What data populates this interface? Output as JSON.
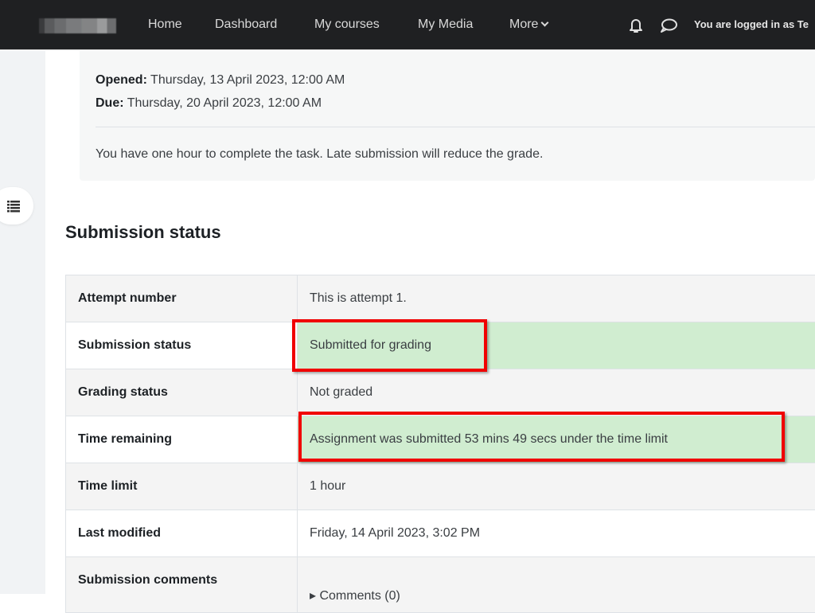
{
  "navbar": {
    "logo_alt": "Site logo (blurred)",
    "items": [
      {
        "label": "Home"
      },
      {
        "label": "Dashboard"
      },
      {
        "label": "My courses"
      },
      {
        "label": "My Media"
      },
      {
        "label": "More"
      }
    ],
    "notifications_icon": "bell-icon",
    "messages_icon": "chat-bubble-icon",
    "user_text": "You are logged in as Te"
  },
  "drawer": {
    "toggle_icon": "list-icon"
  },
  "activity_info": {
    "opened_label": "Opened:",
    "opened_value": " Thursday, 13 April 2023, 12:00 AM",
    "due_label": "Due:",
    "due_value": " Thursday, 20 April 2023, 12:00 AM",
    "description": "You have one hour to complete the task. Late submission will reduce the grade."
  },
  "submission": {
    "title": "Submission status",
    "rows": [
      {
        "label": "Attempt number",
        "value": "This is attempt 1."
      },
      {
        "label": "Submission status",
        "value": "Submitted for grading",
        "status": "success"
      },
      {
        "label": "Grading status",
        "value": "Not graded"
      },
      {
        "label": "Time remaining",
        "value": "Assignment was submitted 53 mins 49 secs under the time limit",
        "status": "success"
      },
      {
        "label": "Time limit",
        "value": "1 hour"
      },
      {
        "label": "Last modified",
        "value": "Friday, 14 April 2023, 3:02 PM"
      },
      {
        "label": "Submission comments",
        "value": "▸ Comments (0)"
      }
    ]
  },
  "colors": {
    "navbar_bg": "#1f2022",
    "success_bg": "#d0edd0",
    "highlight_border": "#f00000"
  }
}
